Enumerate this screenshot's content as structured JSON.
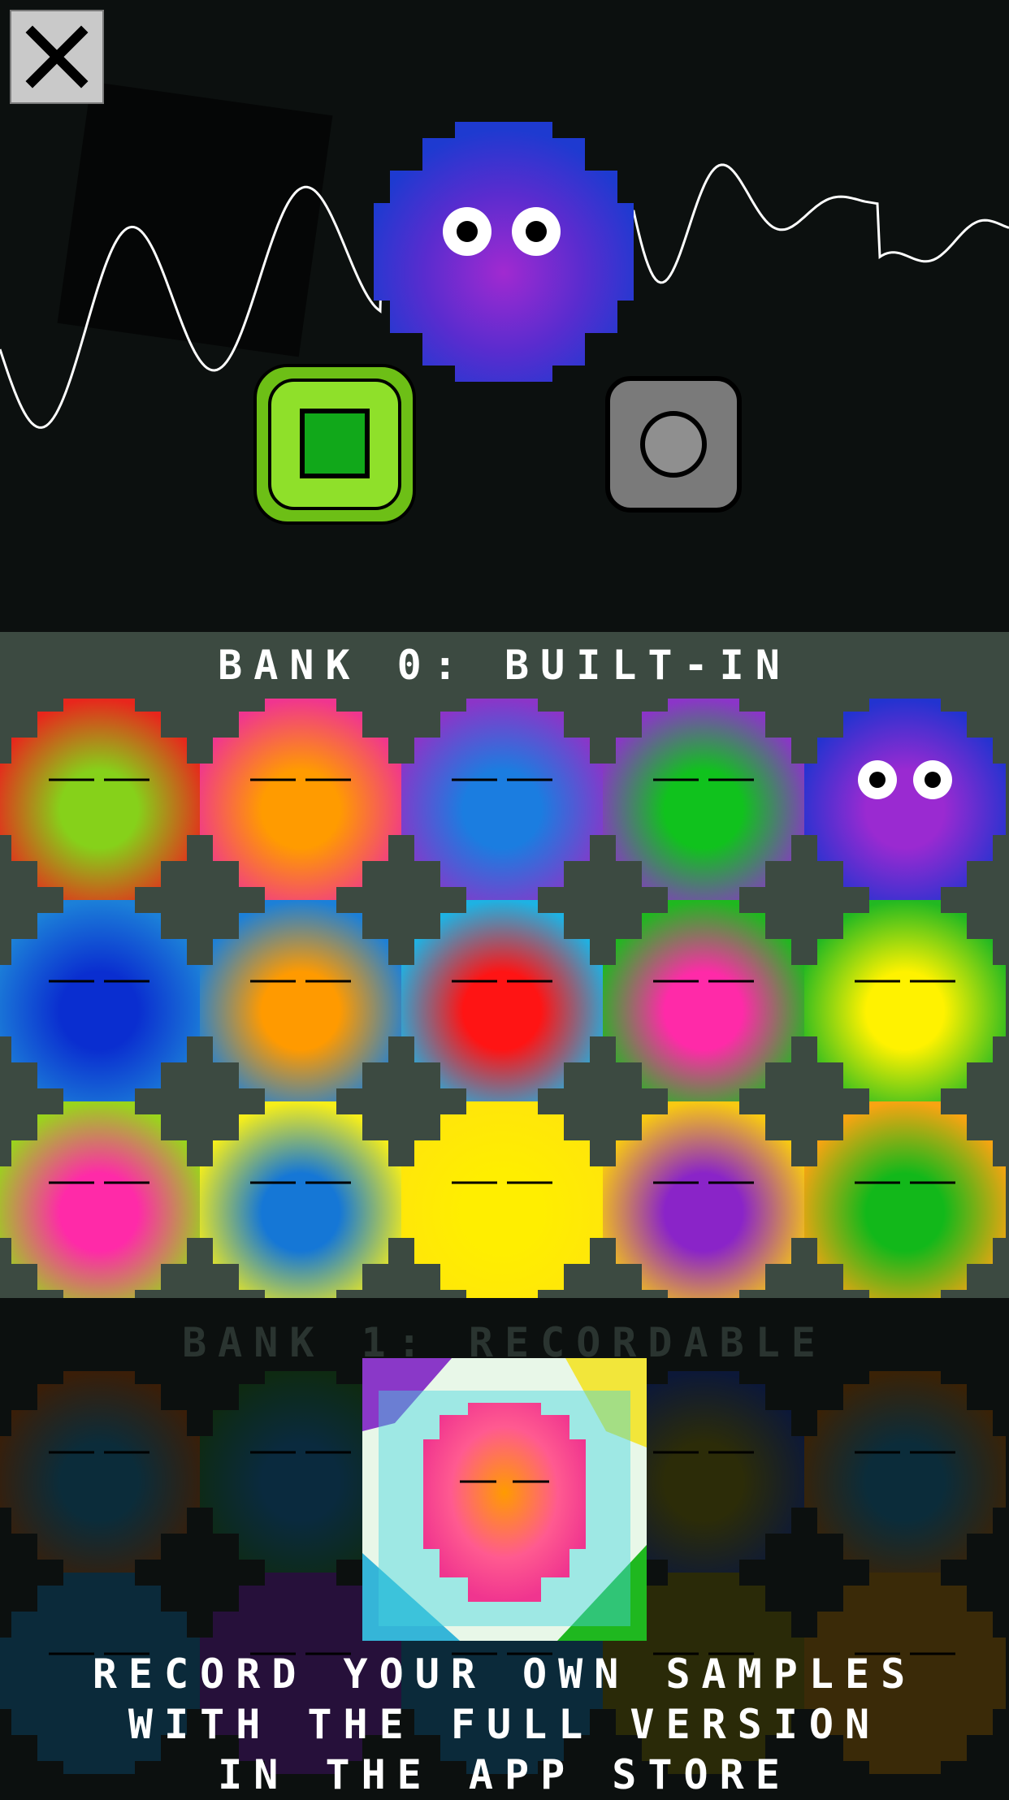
{
  "close_button": {
    "icon": "close-icon"
  },
  "controls": {
    "stop_icon": "stop-square-icon",
    "record_icon": "record-circle-icon",
    "mascot_icon": "mascot-blob-icon"
  },
  "bank0": {
    "title": "BANK 0: BUILT-IN",
    "blobs": [
      {
        "outer": "#e8261c",
        "inner": "#86d11a"
      },
      {
        "outer": "#f0358f",
        "inner": "#ff9b00"
      },
      {
        "outer": "#8b35c8",
        "inner": "#1b7de0"
      },
      {
        "outer": "#8b35c8",
        "inner": "#10c21d"
      },
      {
        "outer": "#2233d0",
        "inner": "#9a2ad1",
        "eyes": true
      },
      {
        "outer": "#1c80d8",
        "inner": "#0a2ed0"
      },
      {
        "outer": "#1c80d8",
        "inner": "#ff9a00"
      },
      {
        "outer": "#1eb2e3",
        "inner": "#ff1414"
      },
      {
        "outer": "#1fb81f",
        "inner": "#ff2aa8"
      },
      {
        "outer": "#22b822",
        "inner": "#fff200"
      },
      {
        "outer": "#9ad41c",
        "inner": "#ff2aa8"
      },
      {
        "outer": "#f6ee1a",
        "inner": "#1577d6"
      },
      {
        "outer": "#ffe60a",
        "inner": "#ffee00"
      },
      {
        "outer": "#f8c912",
        "inner": "#8a24c8"
      },
      {
        "outer": "#f8a412",
        "inner": "#12b81a"
      }
    ]
  },
  "bank1": {
    "title": "BANK 1: RECORDABLE",
    "blobs": [
      {
        "outer": "#3a1e08",
        "inner": "#0b2c3a"
      },
      {
        "outer": "#0e2a12",
        "inner": "#0a2a3e"
      },
      {
        "outer": "#0e2a12",
        "inner": "#0a2a3e"
      },
      {
        "outer": "#0c1838",
        "inner": "#2c2c08"
      },
      {
        "outer": "#3a2206",
        "inner": "#0b2c3a"
      },
      {
        "outer": "#0b2a3a",
        "inner": "#0b2a3a"
      },
      {
        "outer": "#26103a",
        "inner": "#26103a"
      },
      {
        "outer": "#0b2a3a",
        "inner": "#0b2a3a"
      },
      {
        "outer": "#2a2a08",
        "inner": "#2a2a08"
      },
      {
        "outer": "#3a2a08",
        "inner": "#3a2a08"
      }
    ],
    "preview_outer": "#f0358f",
    "preview_inner": "#ff9b00"
  },
  "promo": {
    "line1": "RECORD YOUR OWN SAMPLES",
    "line2": "WITH THE FULL VERSION",
    "line3": "IN THE APP STORE"
  },
  "colors": {
    "background": "#0c100f",
    "bank0_bg": "#3c4a41",
    "stop_green": "#7ed321",
    "record_gray": "#7a7a7a"
  }
}
